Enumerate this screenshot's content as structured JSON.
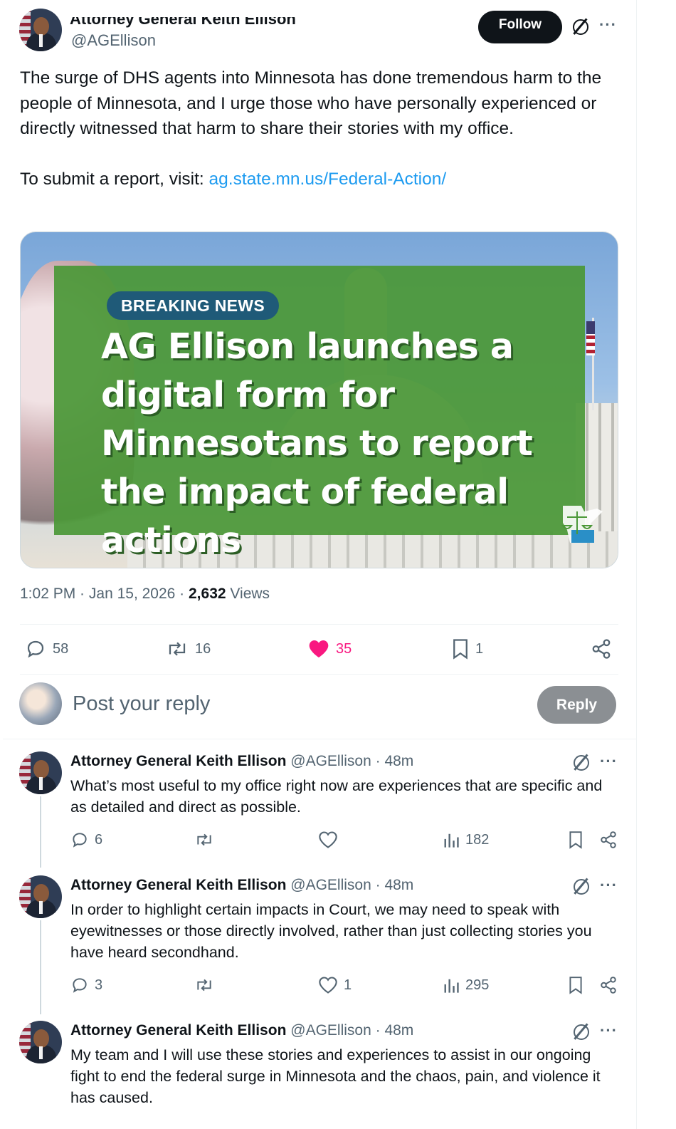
{
  "header": {
    "author_name_partial": "Attorney General Keith Ellison",
    "handle": "@AGEllison",
    "follow_label": "Follow"
  },
  "tweet": {
    "paragraph1": "The surge of DHS agents into Minnesota has done tremendous harm to the people of Minnesota, and I urge those who have personally experienced or directly witnessed that harm to share their stories with my office.",
    "report_prefix": "To submit a report, visit: ",
    "report_link": "ag.state.mn.us/Federal-Action/",
    "media": {
      "badge": "BREAKING NEWS",
      "headline": "AG Ellison launches a digital form for Minnesotans to report the impact of federal actions"
    },
    "time": "1:02 PM",
    "date": "Jan 15, 2026",
    "views_count": "2,632",
    "views_label": "Views",
    "stats": {
      "replies": "58",
      "reposts": "16",
      "likes": "35",
      "bookmarks": "1"
    },
    "accent_like_color": "#f91880",
    "link_color": "#1d9bf0"
  },
  "composer": {
    "placeholder": "Post your reply",
    "reply_label": "Reply"
  },
  "replies": [
    {
      "name": "Attorney General Keith Ellison",
      "handle": "@AGEllison",
      "time": "48m",
      "text": "What’s most useful to my office right now are experiences that are specific and as detailed and direct as possible.",
      "replies": "6",
      "reposts": "",
      "likes": "",
      "views": "182"
    },
    {
      "name": "Attorney General Keith Ellison",
      "handle": "@AGEllison",
      "time": "48m",
      "text": "In order to highlight certain impacts in Court, we may need to speak with eyewitnesses or those directly involved, rather than just collecting stories you have heard secondhand.",
      "replies": "3",
      "reposts": "",
      "likes": "1",
      "views": "295"
    },
    {
      "name": "Attorney General Keith Ellison",
      "handle": "@AGEllison",
      "time": "48m",
      "text": "My team and I will use these stories and experiences to assist in our ongoing fight to end the federal surge in Minnesota and the chaos, pain, and violence it has caused."
    }
  ],
  "icons": {
    "grok": "grok-icon",
    "more": "more-icon",
    "reply": "reply-icon",
    "repost": "repost-icon",
    "like": "heart-icon",
    "bookmark": "bookmark-icon",
    "share": "share-icon",
    "views": "views-icon"
  }
}
